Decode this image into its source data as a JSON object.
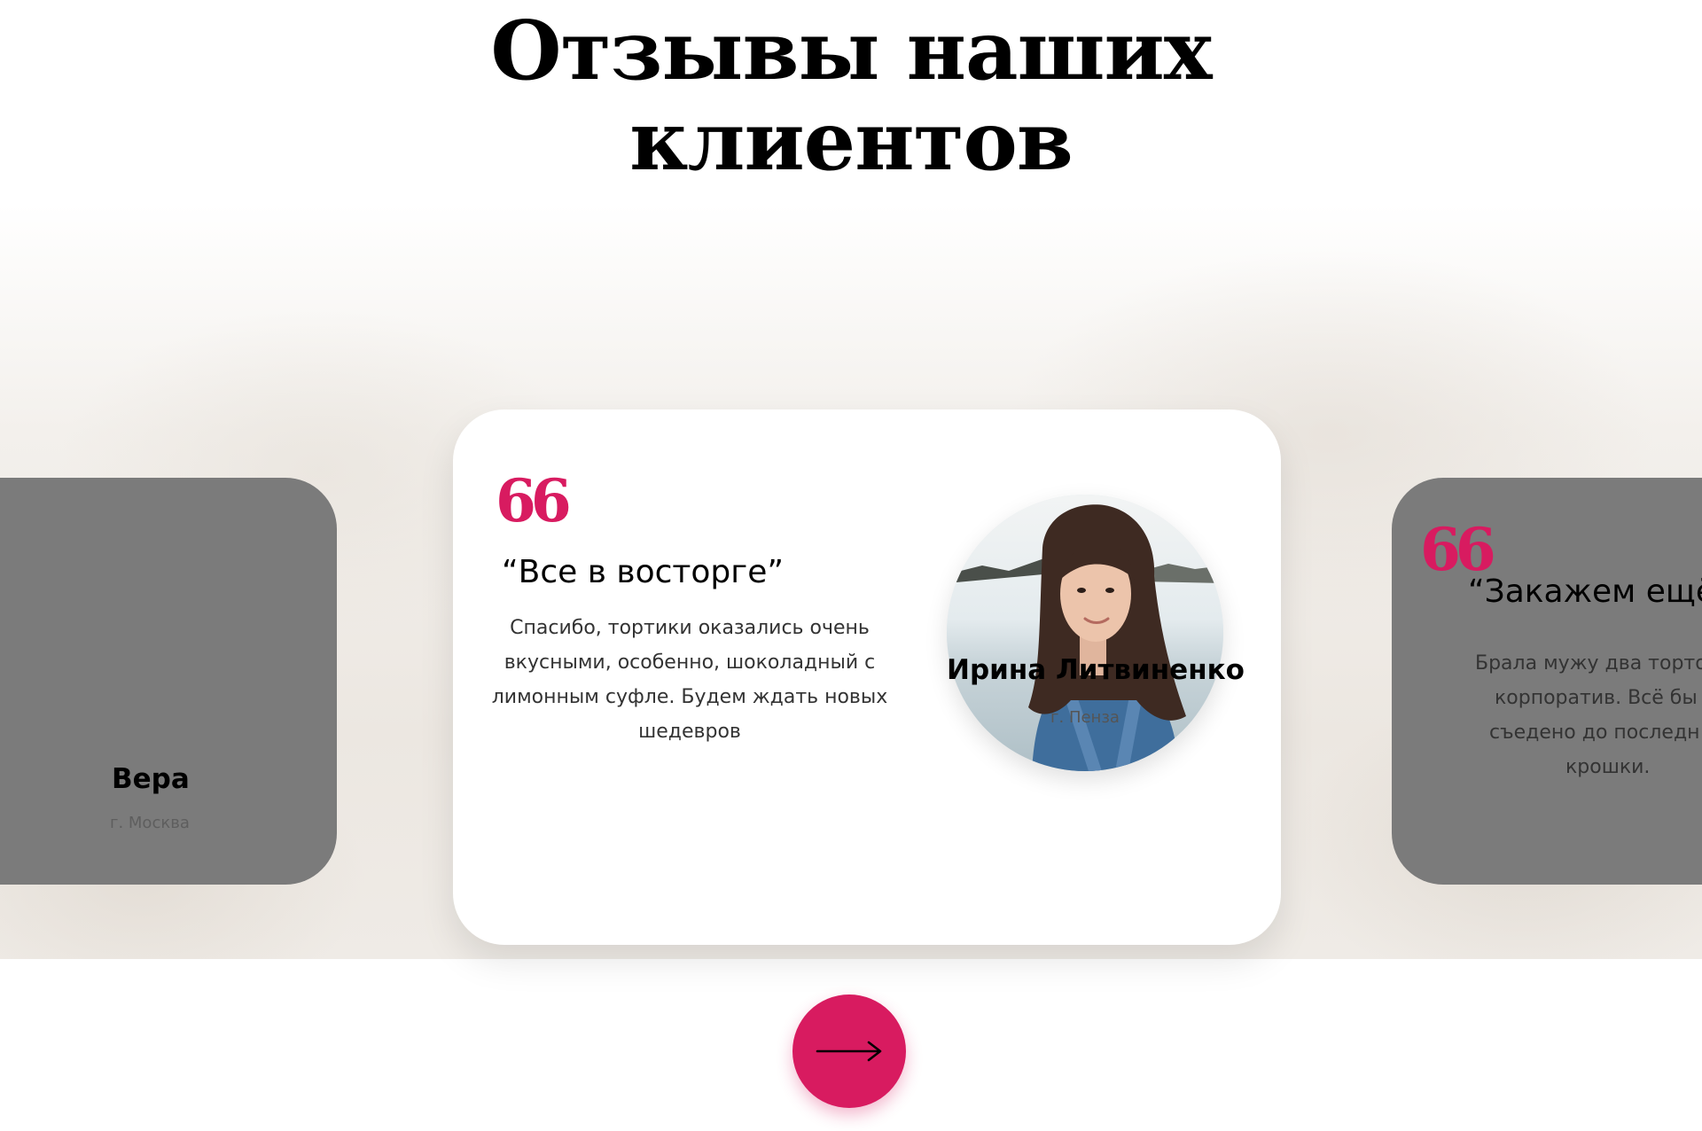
{
  "section": {
    "title_line1": "Отзывы наших",
    "title_line2": "клиентов"
  },
  "reviews": [
    {
      "name": "Вера",
      "city": "г. Москва"
    },
    {
      "quote_mark": "66",
      "title": "“Все в восторге”",
      "text": "Спасибо, тортики оказались очень вкусными, особенно, шоколадный с лимонным суфле. Будем ждать новых шедевров",
      "name": "Ирина Литвиненко",
      "city": "г. Пенза"
    },
    {
      "quote_mark": "66",
      "title": "“Закажем ещё",
      "text_lines": [
        "Брала мужу два торто",
        "корпоратив. Всё бы",
        "съедено до последн",
        "крошки."
      ]
    }
  ],
  "navigation": {
    "next_icon": "arrow-right-icon"
  },
  "colors": {
    "accent": "#d81b60",
    "side_card": "#7b7b7b",
    "card": "#ffffff"
  }
}
